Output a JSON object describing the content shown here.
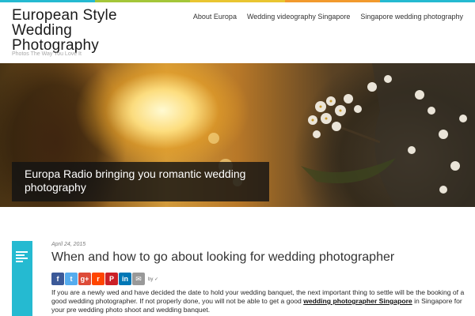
{
  "colors": {
    "accent_bar": [
      "#25bad1",
      "#a4c639",
      "#e9c531",
      "#f29a2e",
      "#25bad1"
    ],
    "post_icon": "#25bad1",
    "facebook": "#3b5998",
    "twitter": "#55acee",
    "google_plus": "#dd4b39",
    "reddit": "#ff4500",
    "pinterest": "#cb2027",
    "linkedin": "#0077b5",
    "email": "#999999"
  },
  "header": {
    "title_line1": "European Style",
    "title_line2": "Wedding",
    "title_line3": "Photography",
    "tagline": "Photos The Way You Love It"
  },
  "nav": {
    "items": [
      {
        "label": "About Europa"
      },
      {
        "label": "Wedding videography Singapore"
      },
      {
        "label": "Singapore wedding photography"
      }
    ]
  },
  "hero": {
    "caption": "Europa Radio bringing you romantic wedding photography"
  },
  "post": {
    "icon": "text-lines-icon",
    "date": "April 24, 2015",
    "title": "When and how to go about looking for wedding photographer",
    "share": {
      "icons": [
        "facebook-icon",
        "twitter-icon",
        "google-plus-icon",
        "reddit-icon",
        "pinterest-icon",
        "linkedin-icon",
        "email-icon"
      ],
      "facebook_glyph": "f",
      "twitter_glyph": "t",
      "google_glyph": "g+",
      "reddit_glyph": "r",
      "pinterest_glyph": "P",
      "linkedin_glyph": "in",
      "email_glyph": "✉",
      "by_label": "by ✓"
    },
    "body_part1": "If you are a newly wed and have decided the date to hold your wedding banquet, the next important thing to settle will be the booking of a good wedding photographer. If not properly done, you will not be able to get a good ",
    "body_link": "wedding photographer Singapore",
    "body_part2": " in Singapore for your pre wedding photo shoot and wedding banquet."
  }
}
